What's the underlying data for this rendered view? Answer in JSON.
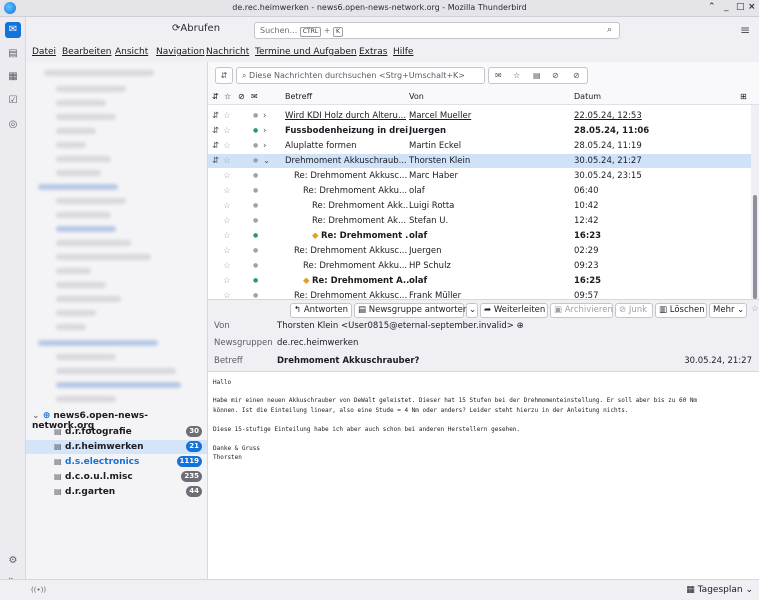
{
  "window": {
    "title": "de.rec.heimwerken - news6.open-news-network.org - Mozilla Thunderbird"
  },
  "toolbar": {
    "fetch_label": "Abrufen",
    "search_placeholder": "Suchen...",
    "shortcut_ctrl": "CTRL",
    "shortcut_plus": "+",
    "shortcut_key": "K"
  },
  "menu": [
    "Datei",
    "Bearbeiten",
    "Ansicht",
    "Navigation",
    "Nachricht",
    "Termine und Aufgaben",
    "Extras",
    "Hilfe"
  ],
  "account": {
    "name": "news6.open-news-network.org"
  },
  "folders": [
    {
      "name": "d.r.fotografie",
      "count": "30"
    },
    {
      "name": "d.r.heimwerken",
      "count": "21"
    },
    {
      "name": "d.s.electronics",
      "count": "1119"
    },
    {
      "name": "d.c.o.u.l.misc",
      "count": "235"
    },
    {
      "name": "d.r.garten",
      "count": "44"
    }
  ],
  "message_search": {
    "placeholder": "Diese Nachrichten durchsuchen <Strg+Umschalt+K>"
  },
  "columns": {
    "subject": "Betreff",
    "from": "Von",
    "date": "Datum"
  },
  "messages": [
    {
      "subject": "Wird KDI Holz durch Alteru...",
      "from": "Marcel Mueller",
      "date": "22.05.24, 12:53"
    },
    {
      "subject": "Fussbodenheizung in drei...",
      "from": "Juergen",
      "date": "28.05.24, 11:06"
    },
    {
      "subject": "Aluplatte formen",
      "from": "Martin Eckel",
      "date": "28.05.24, 11:19"
    },
    {
      "subject": "Drehmoment Akkuschraub...",
      "from": "Thorsten Klein",
      "date": "30.05.24, 21:27"
    },
    {
      "subject": "Re: Drehmoment Akkusc...",
      "from": "Marc Haber",
      "date": "30.05.24, 23:15"
    },
    {
      "subject": "Re: Drehmoment Akku...",
      "from": "olaf",
      "date": "06:40"
    },
    {
      "subject": "Re: Drehmoment Akk...",
      "from": "Luigi Rotta",
      "date": "10:42"
    },
    {
      "subject": "Re: Drehmoment Ak...",
      "from": "Stefan U.",
      "date": "12:42"
    },
    {
      "subject": "Re: Drehmoment ...",
      "from": "olaf",
      "date": "16:23"
    },
    {
      "subject": "Re: Drehmoment Akkusc...",
      "from": "Juergen",
      "date": "02:29"
    },
    {
      "subject": "Re: Drehmoment Akku...",
      "from": "HP Schulz",
      "date": "09:23"
    },
    {
      "subject": "Re: Drehmoment A...",
      "from": "olaf",
      "date": "16:25"
    },
    {
      "subject": "Re: Drehmoment Akkusc...",
      "from": "Frank Müller",
      "date": "09:57"
    }
  ],
  "actions": {
    "reply": "Antworten",
    "reply_newsgroup": "Newsgruppe antworten",
    "forward": "Weiterleiten",
    "archive": "Archivieren",
    "junk": "Junk",
    "delete": "Löschen",
    "more": "Mehr"
  },
  "header": {
    "from_label": "Von",
    "from_value": "Thorsten Klein <User0815@eternal-september.invalid>",
    "newsgroups_label": "Newsgruppen",
    "newsgroups_value": "de.rec.heimwerken",
    "subject_label": "Betreff",
    "subject_value": "Drehmoment Akkuschrauber?",
    "date_value": "30.05.24, 21:27"
  },
  "body": {
    "greeting": "Hallo",
    "p1_l1": "Habe mir einen neuen Akkuschrauber von DeWalt geleistet. Dieser hat 15 Stufen bei der Drehmomenteinstellung. Er soll aber bis zu 60 Nm",
    "p1_l2": "können. Ist die Einteilung linear, also eine Stude = 4 Nm oder anders? Leider steht hierzu in der Anleitung nichts.",
    "p2": "Diese 15-stufige Einteilung habe ich aber auch schon bei anderen Herstellern gesehen.",
    "sign1": "Danke & Gruss",
    "sign2": "Thorsten"
  },
  "statusbar": {
    "today_pane": "Tagesplan"
  }
}
